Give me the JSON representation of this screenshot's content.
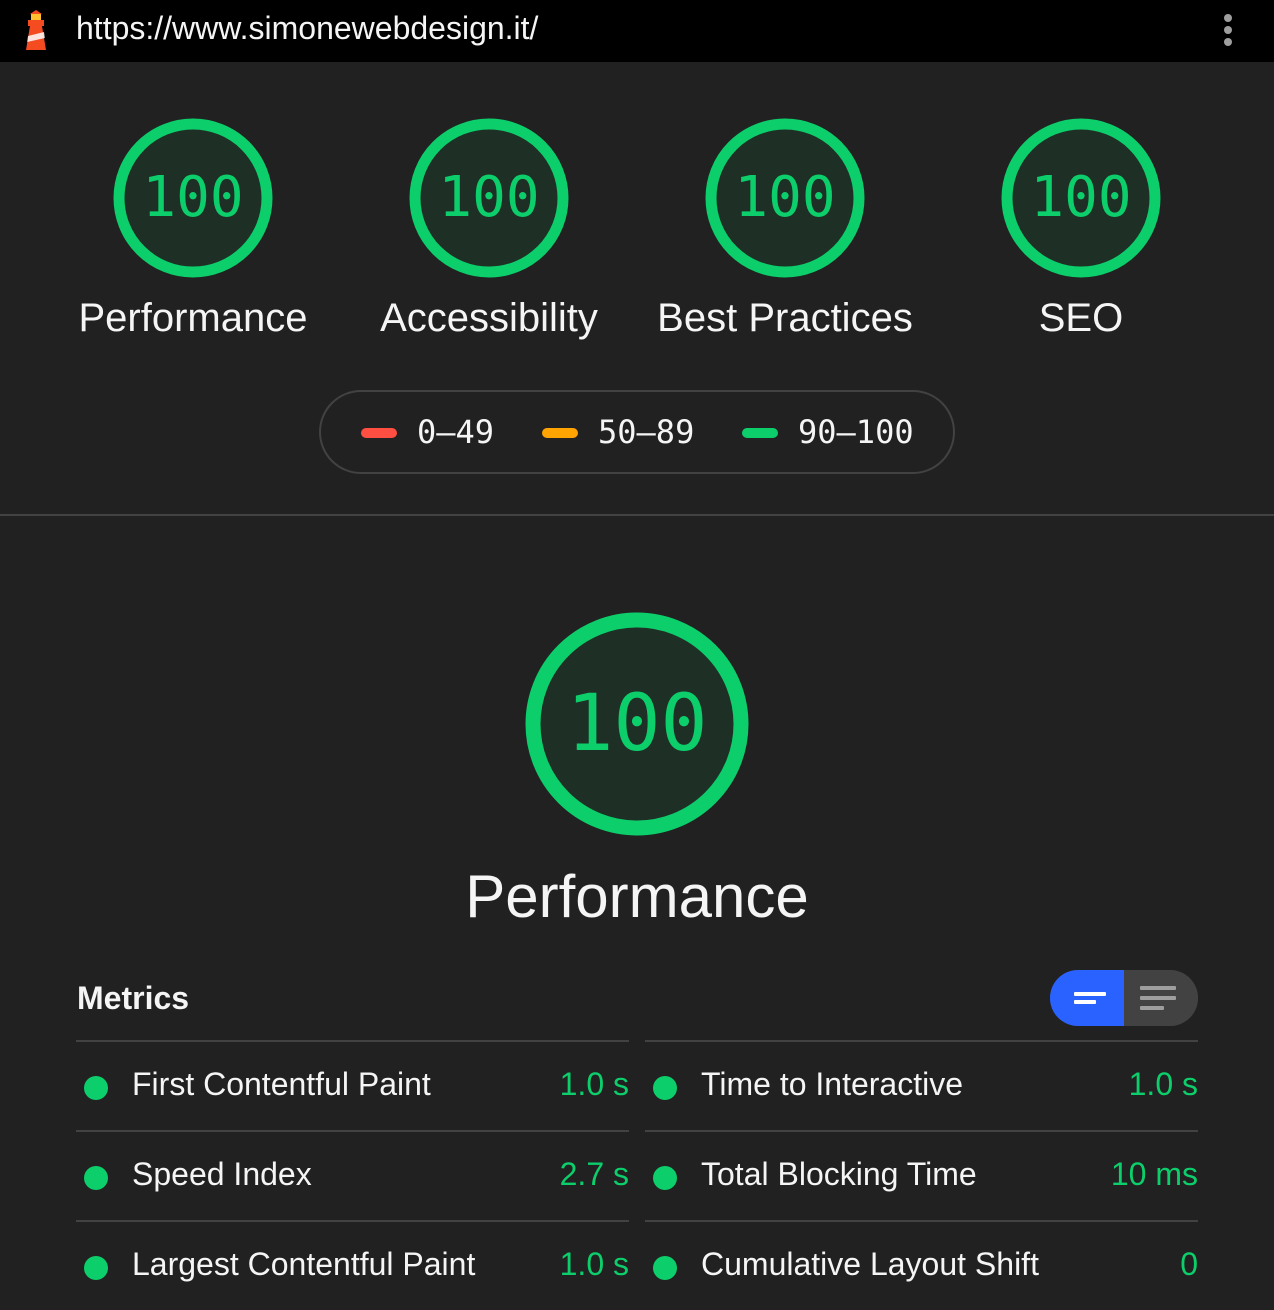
{
  "topbar": {
    "url": "https://www.simonewebdesign.it/",
    "logo_icon": "lighthouse-icon",
    "menu_icon": "more-vert-icon"
  },
  "colors": {
    "pass": "#0cce6b",
    "average": "#ffa400",
    "fail": "#ff4e42",
    "toggle_active": "#2962ff"
  },
  "gauges": [
    {
      "score": "100",
      "label": "Performance"
    },
    {
      "score": "100",
      "label": "Accessibility"
    },
    {
      "score": "100",
      "label": "Best Practices"
    },
    {
      "score": "100",
      "label": "SEO"
    }
  ],
  "legend": [
    {
      "range": "0–49",
      "status": "fail"
    },
    {
      "range": "50–89",
      "status": "average"
    },
    {
      "range": "90–100",
      "status": "pass"
    }
  ],
  "performance": {
    "score": "100",
    "title": "Performance"
  },
  "metrics": {
    "title": "Metrics",
    "toggle": {
      "active_icon": "compact-view-icon",
      "inactive_icon": "expanded-view-icon"
    },
    "items": [
      {
        "name": "First Contentful Paint",
        "value": "1.0 s"
      },
      {
        "name": "Time to Interactive",
        "value": "1.0 s"
      },
      {
        "name": "Speed Index",
        "value": "2.7 s"
      },
      {
        "name": "Total Blocking Time",
        "value": "10 ms"
      },
      {
        "name": "Largest Contentful Paint",
        "value": "1.0 s"
      },
      {
        "name": "Cumulative Layout Shift",
        "value": "0"
      }
    ]
  }
}
